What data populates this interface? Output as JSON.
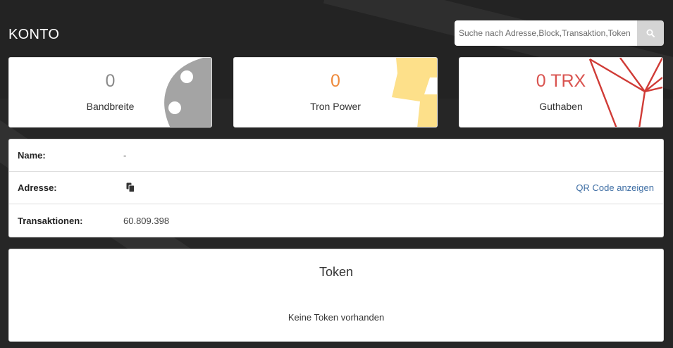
{
  "page": {
    "title": "KONTO"
  },
  "search": {
    "placeholder": "Suche nach Adresse,Block,Transaktion,Token",
    "icon": "search-icon"
  },
  "stats": {
    "bandwidth": {
      "value": "0",
      "label": "Bandbreite",
      "color": "#8a8a8a",
      "icon": "bandwidth-gauge-icon"
    },
    "tron_power": {
      "value": "0",
      "label": "Tron Power",
      "color": "#ee8a3c",
      "icon": "lightning-icon"
    },
    "balance": {
      "value": "0 TRX",
      "label": "Guthaben",
      "color": "#d9534f",
      "icon": "tron-logo-icon"
    }
  },
  "info": {
    "name": {
      "label": "Name:",
      "value": "-"
    },
    "address": {
      "label": "Adresse:",
      "copy_icon": "copy-icon",
      "qr_link": "QR Code anzeigen"
    },
    "transactions": {
      "label": "Transaktionen:",
      "value": "60.809.398"
    }
  },
  "tokens": {
    "title": "Token",
    "empty_message": "Keine Token vorhanden"
  }
}
